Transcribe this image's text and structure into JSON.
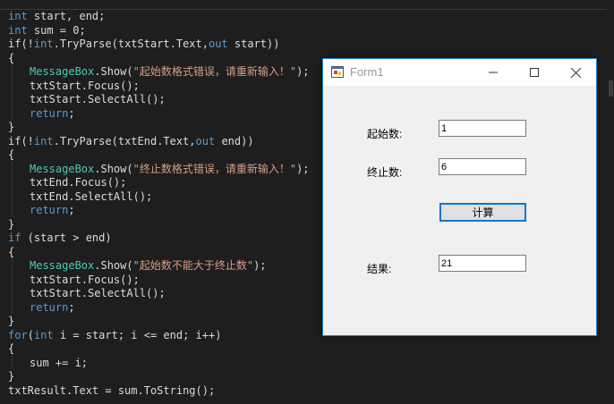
{
  "editor": {
    "lines": [
      [
        [
          "int",
          "kw"
        ],
        [
          " start, end;",
          "plain"
        ]
      ],
      [
        [
          "int",
          "kw"
        ],
        [
          " sum = 0;",
          "plain"
        ]
      ],
      [
        [
          "if(!",
          "plain"
        ],
        [
          "int",
          "kw"
        ],
        [
          ".TryParse(txtStart.Text,",
          "plain"
        ],
        [
          "out",
          "kw"
        ],
        [
          " start))",
          "plain"
        ]
      ],
      [
        [
          "{",
          "plain"
        ]
      ],
      [
        [
          "MessageBox",
          "type"
        ],
        [
          ".Show(",
          "plain"
        ],
        [
          "\"起始数格式错误，请重新输入！\"",
          "str"
        ],
        [
          ");",
          "plain"
        ]
      ],
      [
        [
          "txtStart.Focus();",
          "plain"
        ]
      ],
      [
        [
          "txtStart.SelectAll();",
          "plain"
        ]
      ],
      [
        [
          "return",
          "kw"
        ],
        [
          ";",
          "plain"
        ]
      ],
      [
        [
          "}",
          "plain"
        ]
      ],
      [
        [
          "if(!",
          "plain"
        ],
        [
          "int",
          "kw"
        ],
        [
          ".TryParse(txtEnd.Text,",
          "plain"
        ],
        [
          "out",
          "kw"
        ],
        [
          " end))",
          "plain"
        ]
      ],
      [
        [
          "{",
          "plain"
        ]
      ],
      [
        [
          "MessageBox",
          "type"
        ],
        [
          ".Show(",
          "plain"
        ],
        [
          "\"终止数格式错误，请重新输入！\"",
          "str"
        ],
        [
          ");",
          "plain"
        ]
      ],
      [
        [
          "txtEnd.Focus();",
          "plain"
        ]
      ],
      [
        [
          "txtEnd.SelectAll();",
          "plain"
        ]
      ],
      [
        [
          "return",
          "kw"
        ],
        [
          ";",
          "plain"
        ]
      ],
      [
        [
          "}",
          "plain"
        ]
      ],
      [
        [
          "if",
          "kw"
        ],
        [
          " (start > end)",
          "plain"
        ]
      ],
      [
        [
          "{",
          "plain"
        ]
      ],
      [
        [
          "MessageBox",
          "type"
        ],
        [
          ".Show(",
          "plain"
        ],
        [
          "\"起始数不能大于终止数\"",
          "str"
        ],
        [
          ");",
          "plain"
        ]
      ],
      [
        [
          "txtStart.Focus();",
          "plain"
        ]
      ],
      [
        [
          "txtStart.SelectAll();",
          "plain"
        ]
      ],
      [
        [
          "return",
          "kw"
        ],
        [
          ";",
          "plain"
        ]
      ],
      [
        [
          "}",
          "plain"
        ]
      ],
      [
        [
          "for",
          "kw"
        ],
        [
          "(",
          "plain"
        ],
        [
          "int",
          "kw"
        ],
        [
          " i = start; i <= end; i++)",
          "plain"
        ]
      ],
      [
        [
          "{",
          "plain"
        ]
      ],
      [
        [
          "sum += i;",
          "plain"
        ]
      ],
      [
        [
          "}",
          "plain"
        ]
      ],
      [
        [
          "txtResult.Text = sum.ToString();",
          "plain"
        ]
      ]
    ],
    "colors": {
      "kw": "#569cd6",
      "type": "#4ec9b0",
      "str": "#d69d85",
      "plain": "#dcdcdc"
    }
  },
  "form": {
    "title": "Form1",
    "start_label": "起始数:",
    "start_value": "1",
    "end_label": "终止数:",
    "end_value": "6",
    "calc_button": "计算",
    "result_label": "结果:",
    "result_value": "21",
    "icons": {
      "app": "form-app-icon",
      "minimize": "minimize-icon",
      "maximize": "maximize-icon",
      "close": "close-icon"
    }
  }
}
